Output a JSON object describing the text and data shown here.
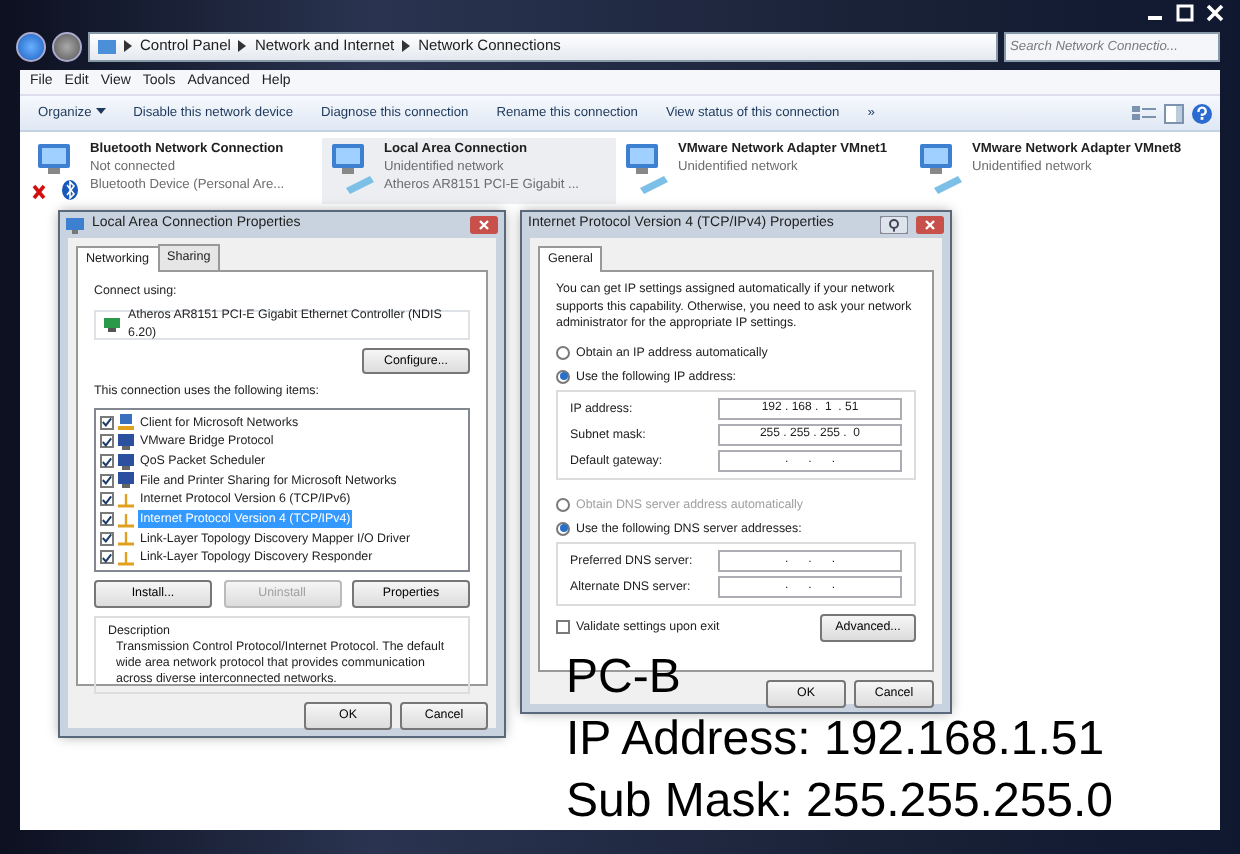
{
  "address_bar": {
    "breadcrumb": [
      "Control Panel",
      "Network and Internet",
      "Network Connections"
    ],
    "search_placeholder": "Search Network Connectio..."
  },
  "menu": [
    "File",
    "Edit",
    "View",
    "Tools",
    "Advanced",
    "Help"
  ],
  "toolbar": {
    "organize": "Organize",
    "commands": [
      "Disable this network device",
      "Diagnose this connection",
      "Rename this connection",
      "View status of this connection"
    ],
    "overflow": "»"
  },
  "connections": [
    {
      "name": "Bluetooth Network Connection",
      "lines": [
        "Not connected",
        "Bluetooth Device (Personal Are..."
      ],
      "kind": "bluetooth",
      "disconnected": true,
      "selected": false
    },
    {
      "name": "Local Area Connection",
      "lines": [
        "Unidentified network",
        "Atheros AR8151 PCI-E Gigabit ..."
      ],
      "kind": "ethernet",
      "disconnected": false,
      "selected": true
    },
    {
      "name": "VMware Network Adapter VMnet1",
      "lines": [
        "Unidentified network"
      ],
      "kind": "ethernet",
      "disconnected": false,
      "selected": false
    },
    {
      "name": "VMware Network Adapter VMnet8",
      "lines": [
        "Unidentified network"
      ],
      "kind": "ethernet",
      "disconnected": false,
      "selected": false
    }
  ],
  "lan_dialog": {
    "title": "Local Area Connection Properties",
    "tabs": [
      {
        "label": "Networking",
        "selected": true
      },
      {
        "label": "Sharing",
        "selected": false
      }
    ],
    "connect_using_label": "Connect using:",
    "adapter": "Atheros AR8151 PCI-E Gigabit Ethernet Controller (NDIS 6.20)",
    "configure_button": "Configure...",
    "items_label": "This connection uses the following items:",
    "items": [
      {
        "label": "Client for Microsoft Networks",
        "kind": "client",
        "checked": true,
        "selected": false
      },
      {
        "label": "VMware Bridge Protocol",
        "kind": "service",
        "checked": true,
        "selected": false
      },
      {
        "label": "QoS Packet Scheduler",
        "kind": "service",
        "checked": true,
        "selected": false
      },
      {
        "label": "File and Printer Sharing for Microsoft Networks",
        "kind": "service",
        "checked": true,
        "selected": false
      },
      {
        "label": "Internet Protocol Version 6 (TCP/IPv6)",
        "kind": "protocol",
        "checked": true,
        "selected": false
      },
      {
        "label": "Internet Protocol Version 4 (TCP/IPv4)",
        "kind": "protocol",
        "checked": true,
        "selected": true
      },
      {
        "label": "Link-Layer Topology Discovery Mapper I/O Driver",
        "kind": "protocol",
        "checked": true,
        "selected": false
      },
      {
        "label": "Link-Layer Topology Discovery Responder",
        "kind": "protocol",
        "checked": true,
        "selected": false
      }
    ],
    "item_buttons": [
      {
        "label": "Install...",
        "disabled": false
      },
      {
        "label": "Uninstall",
        "disabled": true
      },
      {
        "label": "Properties",
        "disabled": false
      }
    ],
    "description_label": "Description",
    "description": "Transmission Control Protocol/Internet Protocol. The default wide area network protocol that provides communication across diverse interconnected networks.",
    "buttons": [
      "OK",
      "Cancel"
    ]
  },
  "ipv4_dialog": {
    "title": "Internet Protocol Version 4 (TCP/IPv4) Properties",
    "tabs": [
      {
        "label": "General",
        "selected": true
      }
    ],
    "intro": "You can get IP settings assigned automatically if your network supports this capability. Otherwise, you need to ask your network administrator for the appropriate IP settings.",
    "ip_options": [
      {
        "label": "Obtain an IP address automatically",
        "selected": false,
        "disabled": false
      },
      {
        "label": "Use the following IP address:",
        "selected": true,
        "disabled": false
      }
    ],
    "ip_fields": [
      {
        "label": "IP address:",
        "value": "192 . 168 .  1  . 51"
      },
      {
        "label": "Subnet mask:",
        "value": "255 . 255 . 255 .  0"
      },
      {
        "label": "Default gateway:",
        "value": ".      .      ."
      }
    ],
    "dns_options": [
      {
        "label": "Obtain DNS server address automatically",
        "selected": false,
        "disabled": true
      },
      {
        "label": "Use the following DNS server addresses:",
        "selected": true,
        "disabled": false
      }
    ],
    "dns_fields": [
      {
        "label": "Preferred DNS server:",
        "value": ".      .      ."
      },
      {
        "label": "Alternate DNS server:",
        "value": ".      .      ."
      }
    ],
    "validate": {
      "label": "Validate settings upon exit",
      "checked": false
    },
    "advanced_button": "Advanced...",
    "buttons": [
      "OK",
      "Cancel"
    ]
  },
  "caption": [
    "PC-B",
    "IP Address: 192.168.1.51",
    "Sub Mask: 255.255.255.0"
  ]
}
